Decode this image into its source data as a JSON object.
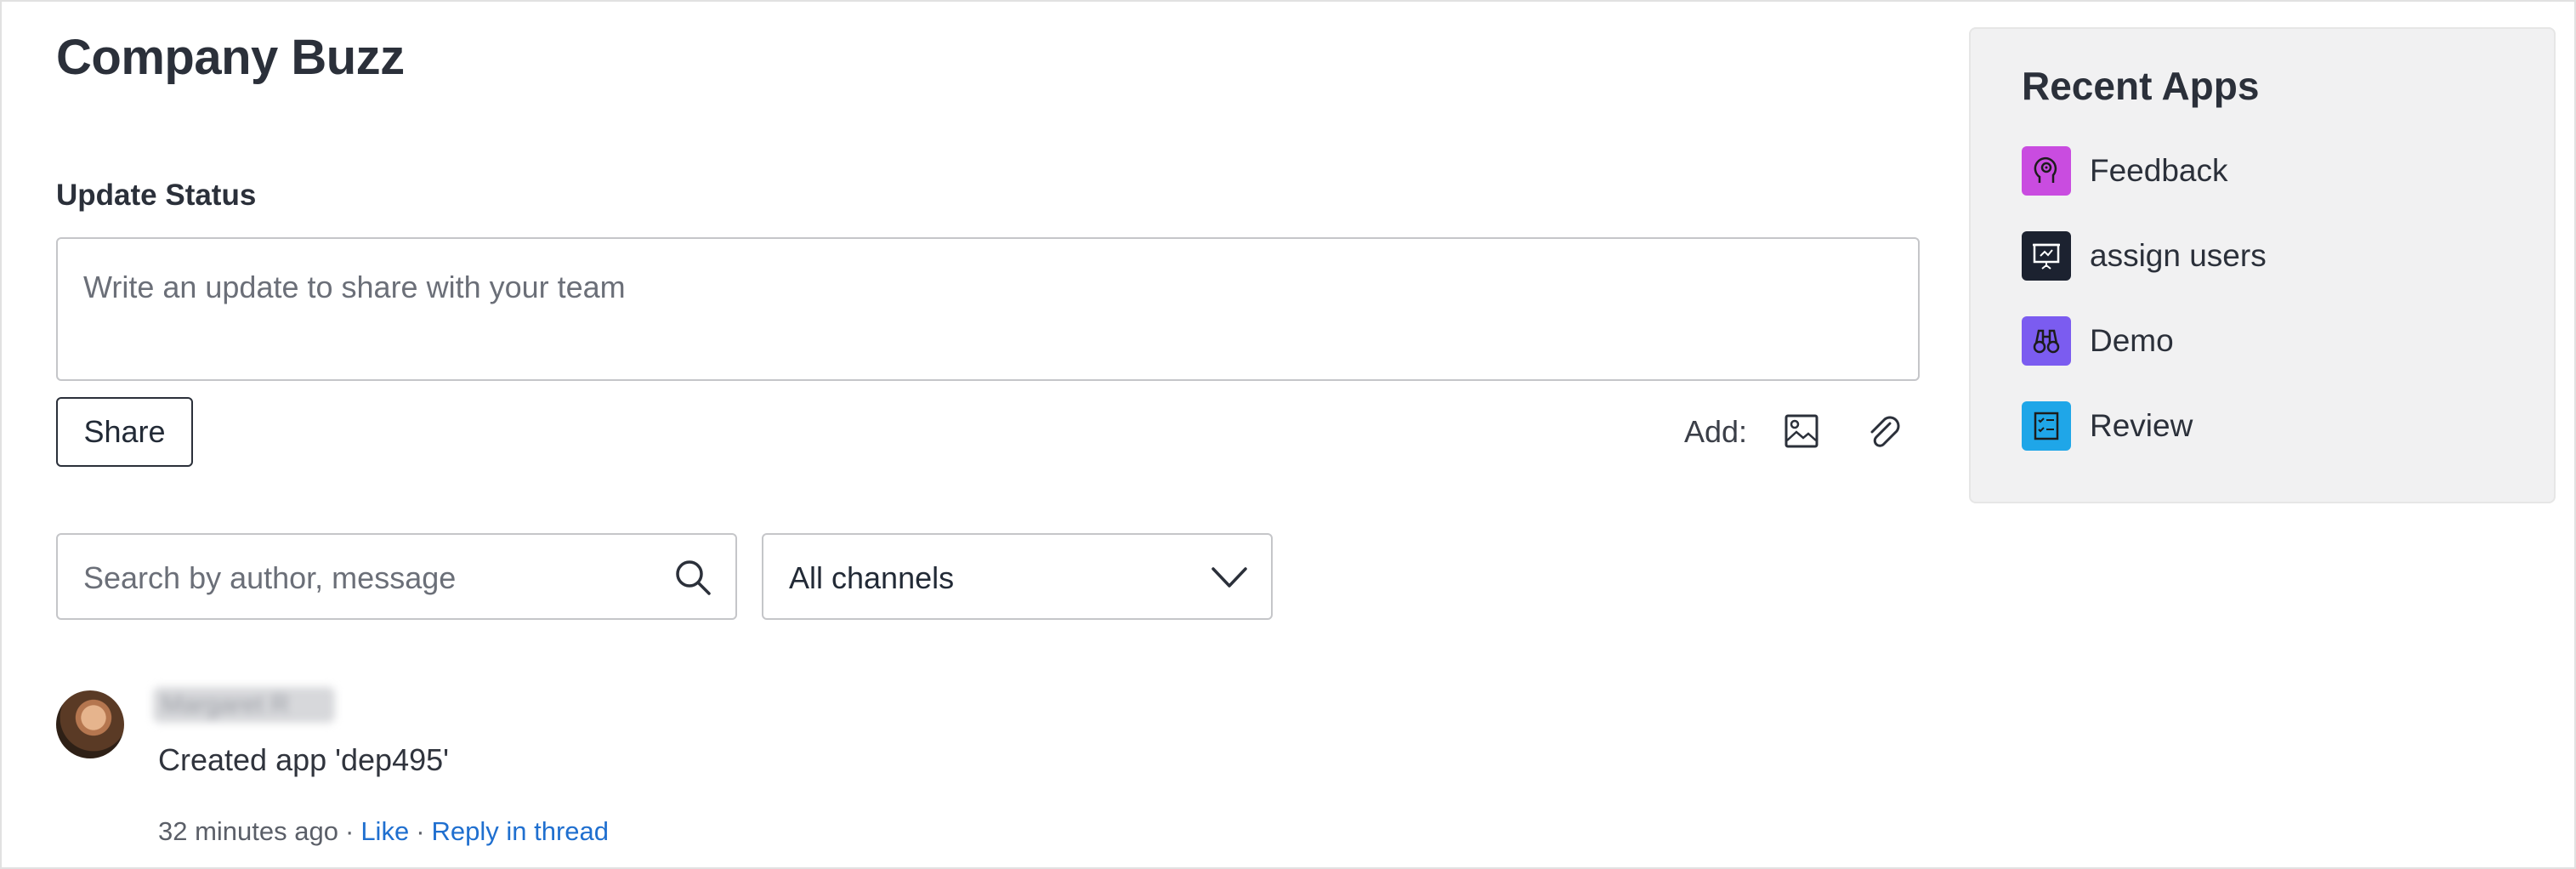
{
  "page": {
    "title": "Company Buzz"
  },
  "update": {
    "label": "Update Status",
    "placeholder": "Write an update to share with your team",
    "share_label": "Share",
    "add_label": "Add:"
  },
  "filters": {
    "search_placeholder": "Search by author, message",
    "channel_value": "All channels"
  },
  "feed": {
    "items": [
      {
        "author": "Margaret R",
        "text": "Created app 'dep495'",
        "time": "32 minutes ago",
        "like_label": "Like",
        "reply_label": "Reply in thread"
      }
    ]
  },
  "recent_apps": {
    "title": "Recent Apps",
    "items": [
      {
        "label": "Feedback",
        "icon": "head-gear-icon",
        "color": "#c94ce0"
      },
      {
        "label": "assign users",
        "icon": "presentation-icon",
        "color": "#1c2230"
      },
      {
        "label": "Demo",
        "icon": "binoculars-icon",
        "color": "#7b5cf0"
      },
      {
        "label": "Review",
        "icon": "checklist-icon",
        "color": "#1fa6e8"
      }
    ]
  },
  "colors": {
    "link": "#1f6fcf",
    "panel_bg": "#f1f1f2"
  }
}
